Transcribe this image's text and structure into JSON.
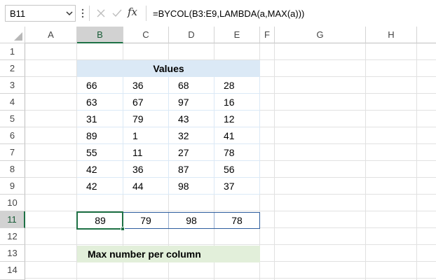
{
  "formula_bar": {
    "name_box": "B11",
    "formula": "=BYCOL(B3:E9,LAMBDA(a,MAX(a)))",
    "fx_label": "fx"
  },
  "columns": [
    "A",
    "B",
    "C",
    "D",
    "E",
    "F",
    "G",
    "H"
  ],
  "rows": [
    "1",
    "2",
    "3",
    "4",
    "5",
    "6",
    "7",
    "8",
    "9",
    "10",
    "11",
    "12",
    "13",
    "14"
  ],
  "selected_column": "B",
  "selected_row": "11",
  "table": {
    "header": "Values",
    "rows": [
      [
        "66",
        "36",
        "68",
        "28"
      ],
      [
        "63",
        "67",
        "97",
        "16"
      ],
      [
        "31",
        "79",
        "43",
        "12"
      ],
      [
        "89",
        "1",
        "32",
        "41"
      ],
      [
        "55",
        "11",
        "27",
        "78"
      ],
      [
        "42",
        "36",
        "87",
        "56"
      ],
      [
        "42",
        "44",
        "98",
        "37"
      ]
    ]
  },
  "result": [
    "89",
    "79",
    "98",
    "78"
  ],
  "note": "Max number per column",
  "colors": {
    "header_fill": "#dbe9f6",
    "note_fill": "#e2efda",
    "selection_green": "#1e7145",
    "result_border": "#2e5e9e"
  }
}
